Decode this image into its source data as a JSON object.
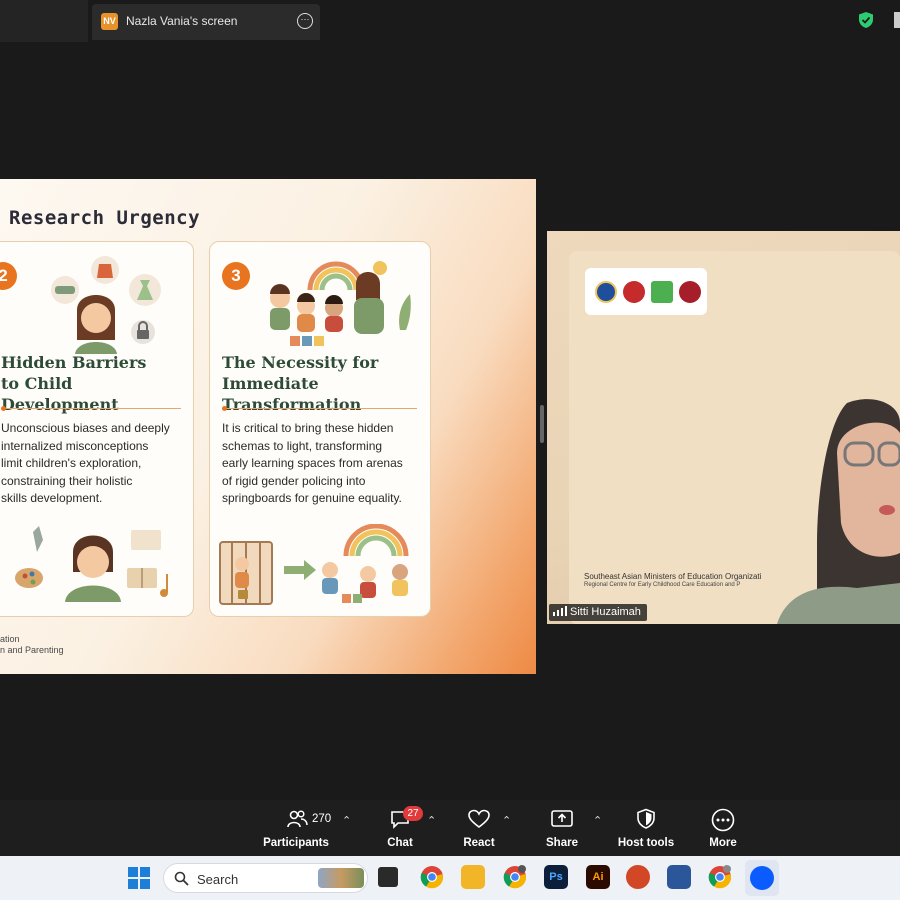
{
  "window": {
    "tab_badge": "NV",
    "tab_title": "Nazla Vania's screen",
    "tab_menu": "⋯"
  },
  "slide": {
    "title": "Research Urgency",
    "card2": {
      "number": "2",
      "title_line1": "Hidden Barriers",
      "title_line2": "to Child Development",
      "body": [
        "Unconscious biases and deeply",
        "internalized misconceptions",
        "limit children's exploration,",
        "constraining their holistic",
        "skills development."
      ]
    },
    "card3": {
      "number": "3",
      "title_line1": "The Necessity for",
      "title_line2": "Immediate Transformation",
      "body": [
        "It is critical to bring these hidden",
        "schemas to light, transforming",
        "early learning spaces from arenas",
        "of rigid gender policing into",
        "springboards for genuine equality."
      ]
    },
    "footer_line1": "ation",
    "footer_line2": "n and Parenting"
  },
  "video": {
    "org_line1": "Southeast Asian Ministers of Education Organizati",
    "org_line2": "Regional Centre for Early Childhood Care Education and P",
    "participant_name": "Sitti Huzaimah"
  },
  "controls": {
    "participants_label": "Participants",
    "participants_count": "270",
    "chat_label": "Chat",
    "chat_badge": "27",
    "react_label": "React",
    "share_label": "Share",
    "host_tools_label": "Host tools",
    "more_label": "More"
  },
  "taskbar": {
    "search_placeholder": "Search",
    "apps": [
      "windows-start",
      "file-explorer",
      "chrome",
      "files",
      "chrome-profile",
      "photoshop",
      "illustrator",
      "powerpoint",
      "word",
      "chrome-profile-2",
      "zoom"
    ]
  },
  "colors": {
    "accent_orange": "#e8741f",
    "card_title_green": "#2e4b37",
    "chat_badge_red": "#e03a3a",
    "shield_green": "#2ecc71"
  }
}
